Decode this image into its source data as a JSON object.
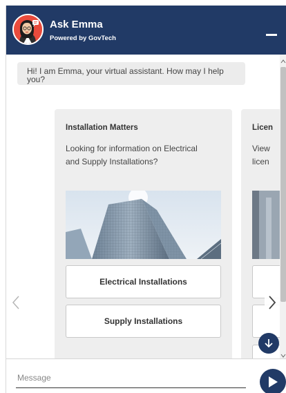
{
  "header": {
    "title": "Ask Emma",
    "subtitle": "Powered by GovTech"
  },
  "chat": {
    "greeting": "Hi! I am Emma, your virtual assistant. How may I help you?"
  },
  "carousel": {
    "cards": [
      {
        "title": "Installation Matters",
        "description": "Looking for information on Electrical\nand Supply Installations?",
        "buttons": [
          "Electrical Installations",
          "Supply Installations"
        ]
      },
      {
        "title": "Licen",
        "description": "View\nlicen",
        "buttons": []
      }
    ]
  },
  "composer": {
    "placeholder": "Message"
  },
  "icons": {
    "avatar": "emma-avatar-icon",
    "minimize": "minimize-icon",
    "prev": "chevron-left-icon",
    "next": "chevron-right-icon",
    "scroll_down": "arrow-down-icon",
    "send": "send-icon"
  },
  "colors": {
    "header": "#213a66",
    "avatar_bg": "#e94b3c",
    "card_bg": "#eeeeee",
    "bubble_bg": "#ececec"
  }
}
